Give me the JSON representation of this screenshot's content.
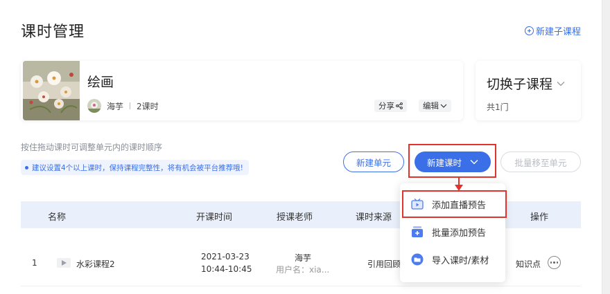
{
  "page": {
    "title": "课时管理",
    "new_sub_course": "新建子课程"
  },
  "course": {
    "name": "绘画",
    "teacher": "海芋",
    "lesson_count": "2课时",
    "share_label": "分享",
    "edit_label": "编辑"
  },
  "switch": {
    "title": "切换子课程",
    "count": "共1门"
  },
  "hint": "按住拖动课时可调整单元内的课时顺序",
  "tip": "建议设置4个以上课时，保持课程完整性，将有机会被平台推荐哦!",
  "toolbar": {
    "new_unit": "新建单元",
    "new_lesson": "新建课时",
    "batch_move": "批量移至单元"
  },
  "dropdown": {
    "items": [
      {
        "label": "添加直播预告",
        "icon": "live-tv-icon"
      },
      {
        "label": "批量添加预告",
        "icon": "batch-add-icon"
      },
      {
        "label": "导入课时/素材",
        "icon": "folder-import-icon"
      }
    ]
  },
  "table": {
    "columns": [
      "名称",
      "开课时间",
      "授课老师",
      "课时来源",
      "操作"
    ],
    "rows": [
      {
        "index": "1",
        "name": "水彩课程2",
        "date": "2021-03-23",
        "time": "10:44-10:45",
        "teacher": "海芋",
        "username": "用户名：xia...",
        "source": "引用回顾",
        "action": "知识点"
      }
    ]
  },
  "colors": {
    "accent": "#3a6fe8",
    "annotation": "#e0332c",
    "header_bg": "#eaf0fb"
  }
}
